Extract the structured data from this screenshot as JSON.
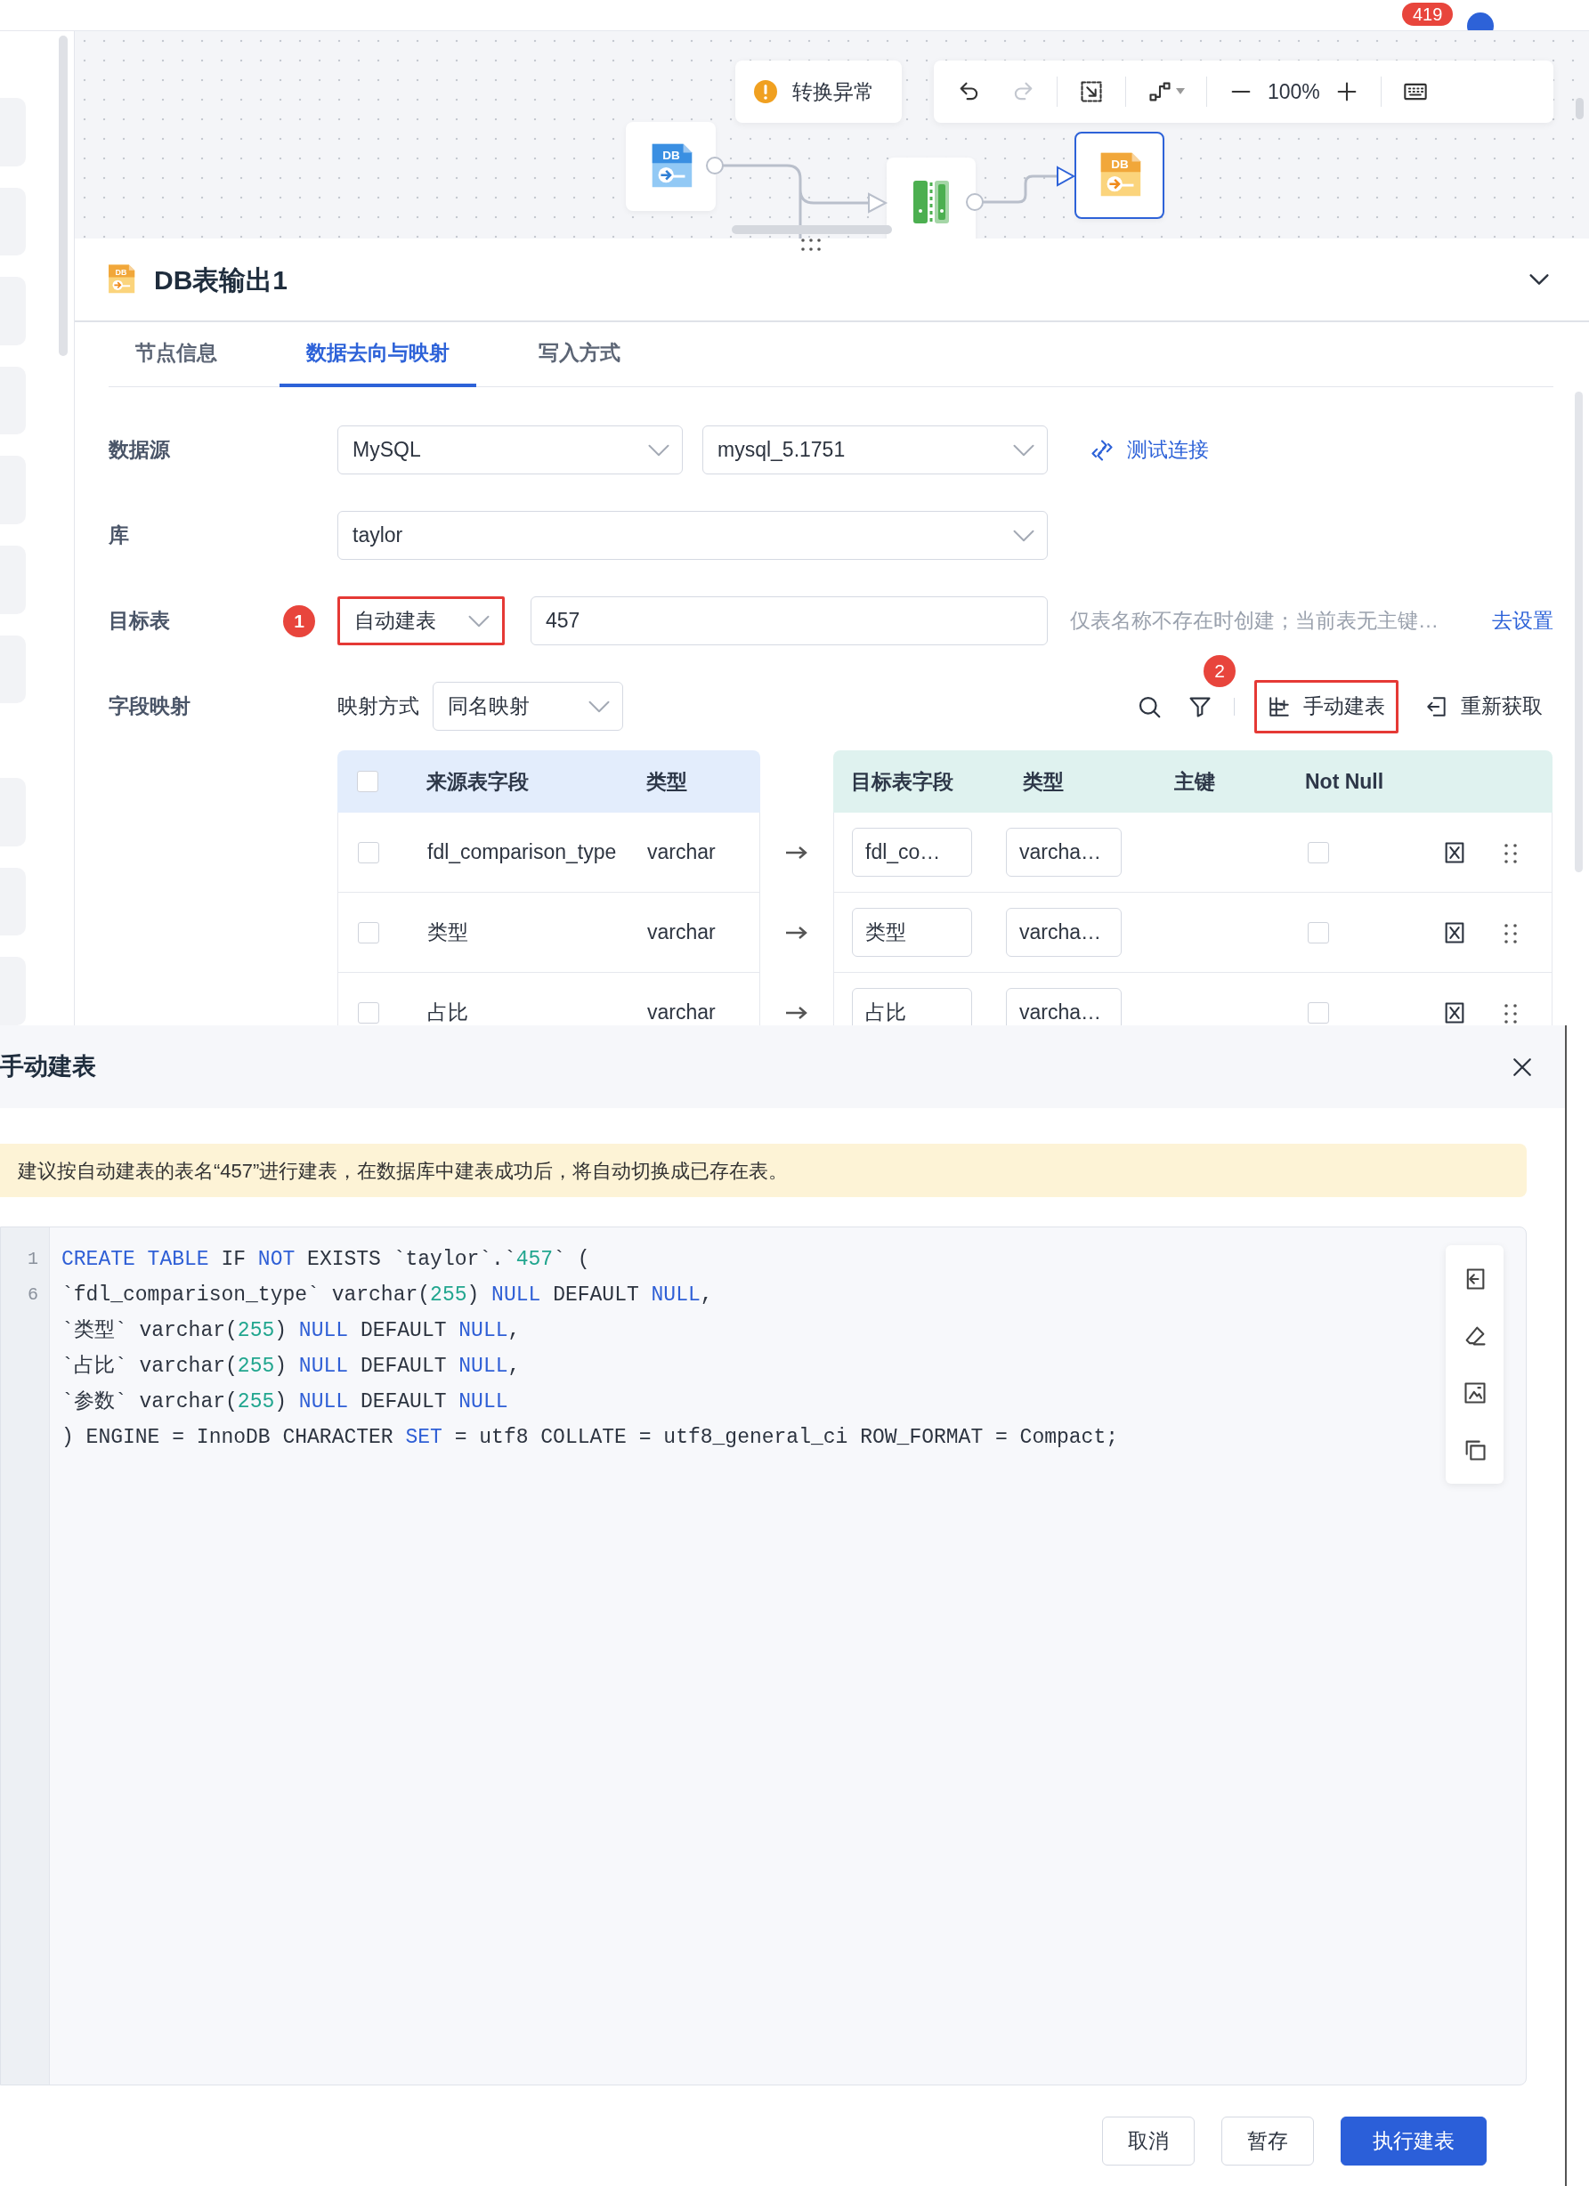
{
  "top_bar": {
    "badge": "419"
  },
  "canvas": {
    "alert": "转换异常",
    "zoom": "100%",
    "tools": [
      {
        "kind": "undo",
        "disabled": false
      },
      {
        "kind": "redo",
        "disabled": true
      },
      {
        "kind": "fit",
        "disabled": false
      },
      {
        "kind": "route",
        "disabled": false
      },
      {
        "kind": "zoom-out",
        "disabled": false
      },
      {
        "kind": "zoom-in",
        "disabled": false
      },
      {
        "kind": "keyboard",
        "disabled": false
      }
    ],
    "nodes": [
      {
        "kind": "db-input",
        "icon_text": "DB",
        "selected": false
      },
      {
        "kind": "transform",
        "selected": false
      },
      {
        "kind": "db-output",
        "icon_text": "DB",
        "selected": true
      }
    ]
  },
  "panel": {
    "icon_text": "DB",
    "title": "DB表输出1",
    "tabs": [
      {
        "label": "节点信息",
        "selected": false
      },
      {
        "label": "数据去向与映射",
        "selected": true
      },
      {
        "label": "写入方式",
        "selected": false
      }
    ],
    "form": {
      "datasource": {
        "label": "数据源",
        "type": "MySQL",
        "connection": "mysql_5.1751",
        "test_link": "测试连接"
      },
      "database": {
        "label": "库",
        "value": "taylor"
      },
      "target": {
        "label": "目标表",
        "step": "1",
        "mode": "自动建表",
        "highlighted": true,
        "name": "457",
        "hint": "仅表名称不存在时创建；当前表无主键…",
        "link": "去设置"
      },
      "mapping": {
        "label": "字段映射",
        "method_label": "映射方式",
        "method": "同名映射",
        "step": "2",
        "actions": [
          {
            "kind": "create",
            "label": "手动建表",
            "highlighted": true
          },
          {
            "kind": "refresh",
            "label": "重新获取",
            "highlighted": false
          }
        ]
      }
    },
    "table": {
      "source_columns": [
        "来源表字段",
        "类型"
      ],
      "target_columns": [
        "目标表字段",
        "类型",
        "主键",
        "Not Null"
      ],
      "all_checked": false,
      "rows": [
        {
          "checked": false,
          "source": "fdl_comparison_type",
          "source_type": "varchar",
          "target": "fdl_co…",
          "target_type": "varcha…",
          "not_null": false
        },
        {
          "checked": false,
          "source": "类型",
          "source_type": "varchar",
          "target": "类型",
          "target_type": "varcha…",
          "not_null": false
        },
        {
          "checked": false,
          "source": "占比",
          "source_type": "varchar",
          "target": "占比",
          "target_type": "varcha…",
          "not_null": false
        }
      ]
    }
  },
  "dialog": {
    "title": "手动建表",
    "notice": "建议按自动建表的表名“457”进行建表，在数据库中建表成功后，将自动切换成已存在表。",
    "gutter": [
      "1",
      "6"
    ],
    "code": [
      [
        {
          "kind": "kw",
          "t": "CREATE TABLE"
        },
        {
          "kind": "p",
          "t": " IF "
        },
        {
          "kind": "kw",
          "t": "NOT"
        },
        {
          "kind": "p",
          "t": " EXISTS `taylor`.`"
        },
        {
          "kind": "num",
          "t": "457"
        },
        {
          "kind": "p",
          "t": "` ("
        }
      ],
      [
        {
          "kind": "p",
          "t": "`fdl_comparison_type` varchar("
        },
        {
          "kind": "num",
          "t": "255"
        },
        {
          "kind": "p",
          "t": ") "
        },
        {
          "kind": "kw",
          "t": "NULL"
        },
        {
          "kind": "p",
          "t": " DEFAULT "
        },
        {
          "kind": "kw",
          "t": "NULL"
        },
        {
          "kind": "p",
          "t": ","
        }
      ],
      [
        {
          "kind": "p",
          "t": "`类型` varchar("
        },
        {
          "kind": "num",
          "t": "255"
        },
        {
          "kind": "p",
          "t": ") "
        },
        {
          "kind": "kw",
          "t": "NULL"
        },
        {
          "kind": "p",
          "t": " DEFAULT "
        },
        {
          "kind": "kw",
          "t": "NULL"
        },
        {
          "kind": "p",
          "t": ","
        }
      ],
      [
        {
          "kind": "p",
          "t": "`占比` varchar("
        },
        {
          "kind": "num",
          "t": "255"
        },
        {
          "kind": "p",
          "t": ") "
        },
        {
          "kind": "kw",
          "t": "NULL"
        },
        {
          "kind": "p",
          "t": " DEFAULT "
        },
        {
          "kind": "kw",
          "t": "NULL"
        },
        {
          "kind": "p",
          "t": ","
        }
      ],
      [
        {
          "kind": "p",
          "t": "`参数` varchar("
        },
        {
          "kind": "num",
          "t": "255"
        },
        {
          "kind": "p",
          "t": ") "
        },
        {
          "kind": "kw",
          "t": "NULL"
        },
        {
          "kind": "p",
          "t": " DEFAULT "
        },
        {
          "kind": "kw",
          "t": "NULL"
        }
      ],
      [
        {
          "kind": "p",
          "t": ") ENGINE = InnoDB CHARACTER "
        },
        {
          "kind": "kw",
          "t": "SET"
        },
        {
          "kind": "p",
          "t": " = utf8 COLLATE = utf8_general_ci ROW_FORMAT = Compact;"
        }
      ]
    ],
    "tools": [
      {
        "kind": "import"
      },
      {
        "kind": "erase"
      },
      {
        "kind": "format"
      },
      {
        "kind": "copy"
      }
    ],
    "buttons": [
      {
        "label": "取消",
        "kind": "default"
      },
      {
        "label": "暂存",
        "kind": "default"
      },
      {
        "label": "执行建表",
        "kind": "primary"
      }
    ]
  }
}
